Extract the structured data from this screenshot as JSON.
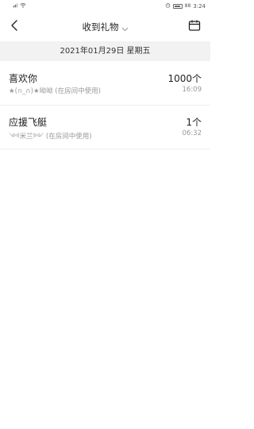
{
  "status_bar": {
    "left_icons": [
      "sim-icon",
      "wifi-icon"
    ],
    "right_icons": [
      "alarm-icon",
      "battery-icon"
    ],
    "battery_text": "88",
    "time": "3:24"
  },
  "header": {
    "title": "收到礼物",
    "back_icon": "chevron-left-icon",
    "title_icon": "chevron-down-icon",
    "calendar_icon": "calendar-icon"
  },
  "date_bar": {
    "text": "2021年01月29日 星期五"
  },
  "gifts": [
    {
      "name": "喜欢你",
      "sender": "★(∩_∩)★呦呦 (在房间中使用)",
      "quantity": "1000个",
      "time": "16:09"
    },
    {
      "name": "应援飞艇",
      "sender": "༺米兰༻ (在房间中使用)",
      "quantity": "1个",
      "time": "06:32"
    }
  ]
}
